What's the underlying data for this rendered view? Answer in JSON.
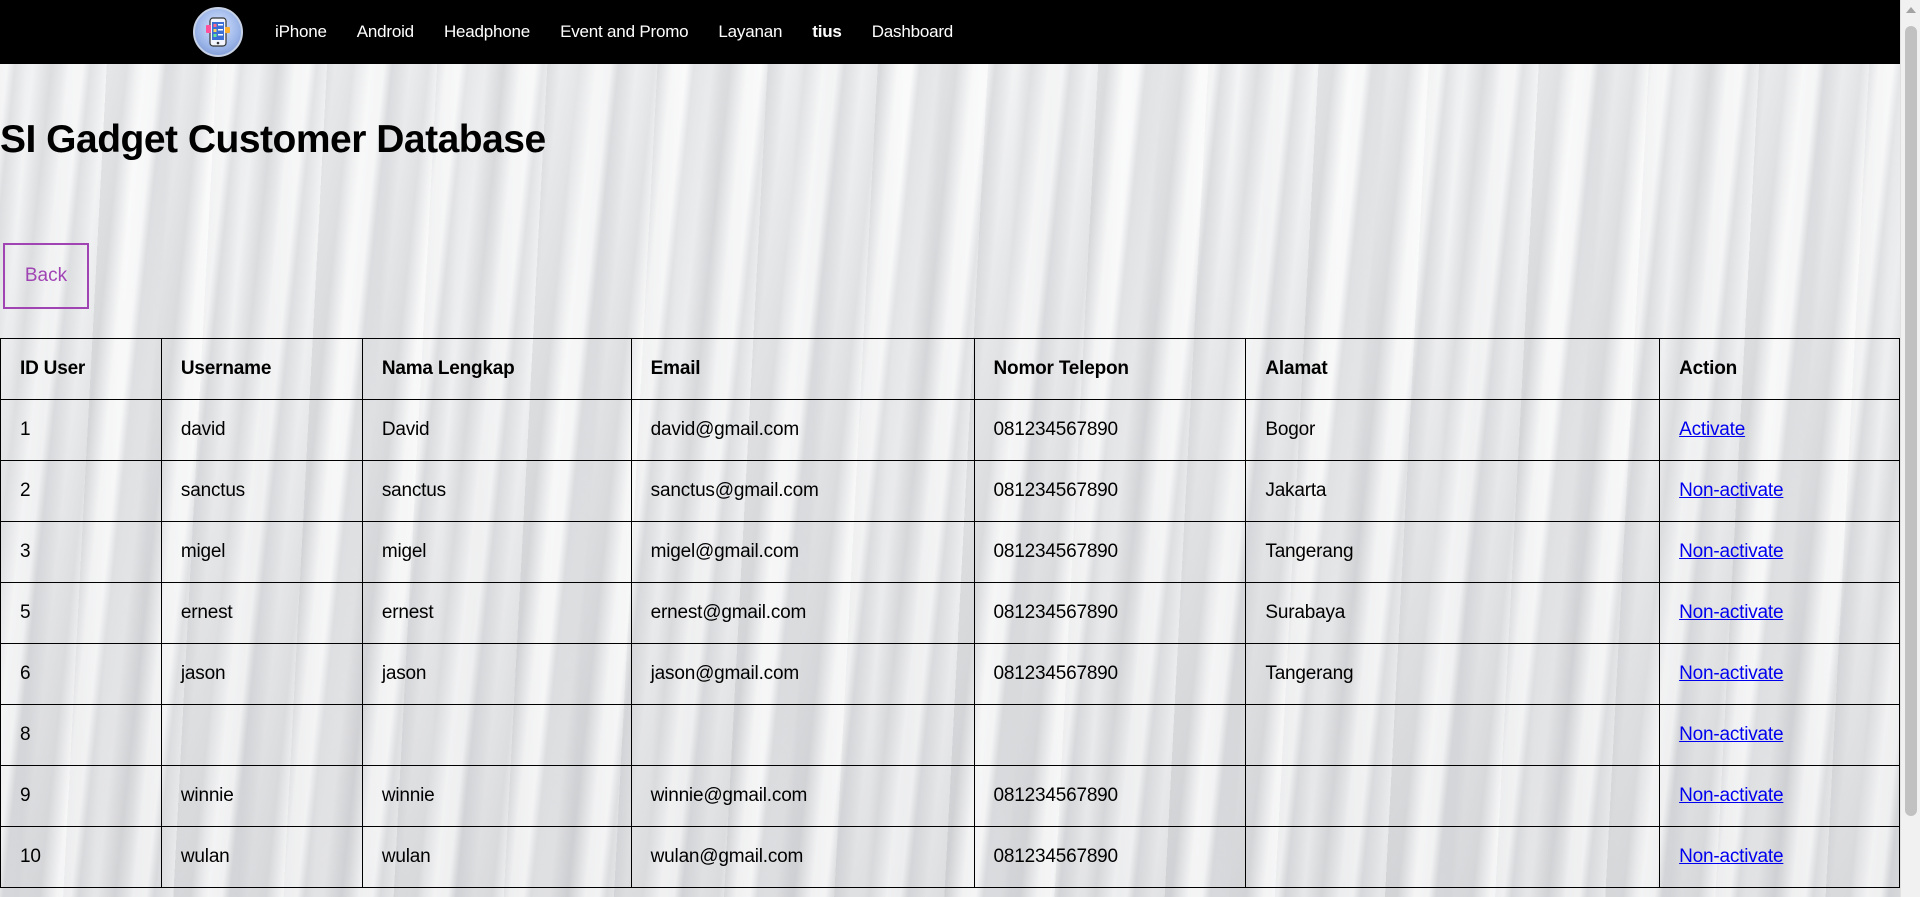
{
  "nav": {
    "logo_icon": "phone-store-logo-icon",
    "items": [
      {
        "label": "iPhone",
        "bold": false
      },
      {
        "label": "Android",
        "bold": false
      },
      {
        "label": "Headphone",
        "bold": false
      },
      {
        "label": "Event and Promo",
        "bold": false
      },
      {
        "label": "Layanan",
        "bold": false
      },
      {
        "label": "tius",
        "bold": true
      },
      {
        "label": "Dashboard",
        "bold": false
      }
    ]
  },
  "page": {
    "title": "SI Gadget Customer Database",
    "back_label": "Back",
    "back_color": "#a044b4"
  },
  "table": {
    "headers": [
      "ID User",
      "Username",
      "Nama Lengkap",
      "Email",
      "Nomor Telepon",
      "Alamat",
      "Action"
    ],
    "rows": [
      {
        "id": "1",
        "username": "david",
        "name": "David",
        "email": "david@gmail.com",
        "phone": "081234567890",
        "address": "Bogor",
        "action": "Activate"
      },
      {
        "id": "2",
        "username": "sanctus",
        "name": "sanctus",
        "email": "sanctus@gmail.com",
        "phone": "081234567890",
        "address": "Jakarta",
        "action": "Non-activate"
      },
      {
        "id": "3",
        "username": "migel",
        "name": "migel",
        "email": "migel@gmail.com",
        "phone": "081234567890",
        "address": "Tangerang",
        "action": "Non-activate"
      },
      {
        "id": "5",
        "username": "ernest",
        "name": "ernest",
        "email": "ernest@gmail.com",
        "phone": "081234567890",
        "address": "Surabaya",
        "action": "Non-activate"
      },
      {
        "id": "6",
        "username": "jason",
        "name": "jason",
        "email": "jason@gmail.com",
        "phone": "081234567890",
        "address": "Tangerang",
        "action": "Non-activate"
      },
      {
        "id": "8",
        "username": "",
        "name": "",
        "email": "",
        "phone": "",
        "address": "",
        "action": "Non-activate"
      },
      {
        "id": "9",
        "username": "winnie",
        "name": "winnie",
        "email": "winnie@gmail.com",
        "phone": "081234567890",
        "address": "",
        "action": "Non-activate"
      },
      {
        "id": "10",
        "username": "wulan",
        "name": "wulan",
        "email": "wulan@gmail.com",
        "phone": "081234567890",
        "address": "",
        "action": "Non-activate"
      }
    ]
  },
  "colors": {
    "navbar_bg": "#000000",
    "link": "#0000ee"
  }
}
